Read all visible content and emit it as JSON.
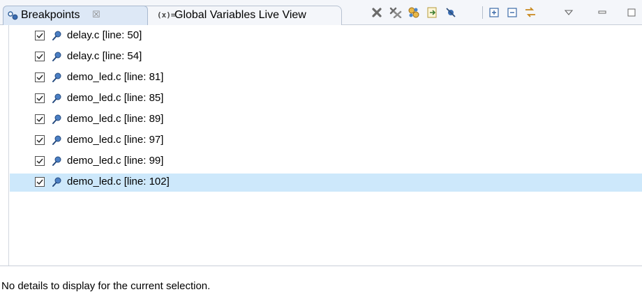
{
  "tabs": [
    {
      "label": "Breakpoints",
      "close": "☒",
      "icon": "breakpoints-view-icon",
      "active": true
    },
    {
      "label": "Global Variables Live View",
      "icon_text": "(x)=",
      "icon": "variables-view-icon",
      "active": false
    }
  ],
  "toolbar": [
    {
      "name": "remove-breakpoint-icon"
    },
    {
      "name": "remove-all-breakpoints-icon"
    },
    {
      "name": "show-supported-breakpoints-icon"
    },
    {
      "name": "go-to-file-icon"
    },
    {
      "name": "skip-all-breakpoints-icon"
    },
    {
      "name": "expand-all-icon"
    },
    {
      "name": "collapse-all-icon"
    },
    {
      "name": "link-with-debug-view-icon"
    },
    {
      "name": "view-menu-icon"
    },
    {
      "name": "minimize-icon"
    },
    {
      "name": "maximize-icon"
    }
  ],
  "breakpoints": [
    {
      "label": "delay.c [line: 50]",
      "checked": true
    },
    {
      "label": "delay.c [line: 54]",
      "checked": true
    },
    {
      "label": "demo_led.c [line: 81]",
      "checked": true
    },
    {
      "label": "demo_led.c [line: 85]",
      "checked": true
    },
    {
      "label": "demo_led.c [line: 89]",
      "checked": true
    },
    {
      "label": "demo_led.c [line: 97]",
      "checked": true
    },
    {
      "label": "demo_led.c [line: 99]",
      "checked": true
    },
    {
      "label": "demo_led.c [line: 102]",
      "checked": true,
      "selected": true
    }
  ],
  "details": {
    "text": "No details to display for the current selection."
  },
  "colors": {
    "selection": "#cde8fb",
    "active_tab": "#dde8f6",
    "breakpoint": "#2e5e9a"
  }
}
